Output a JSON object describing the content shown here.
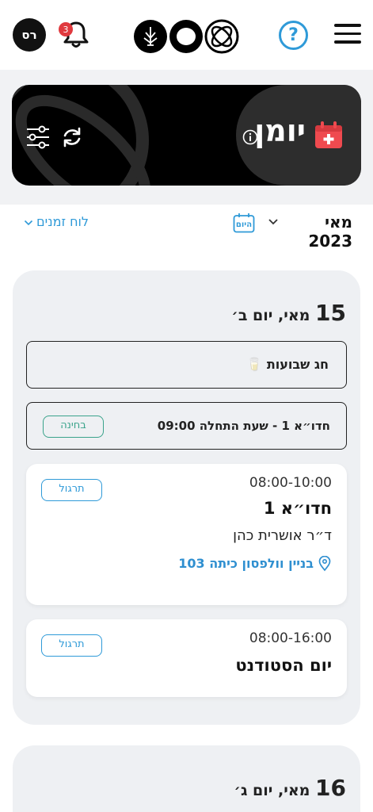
{
  "header": {
    "avatar_initials": "רס",
    "notifications_count": "3",
    "help_label": "?"
  },
  "banner": {
    "title": "יומן"
  },
  "nav": {
    "month_label": "מאי 2023",
    "today_label": "היום",
    "timetable_label": "לוח זמנים"
  },
  "days": [
    {
      "day_number": "15",
      "day_label": "מאי, יום ב׳",
      "holiday": "חג שבועות 🥛",
      "exam": {
        "text": "חדו״א 1 - שעת התחלה 09:00",
        "tag": "בחינה"
      },
      "lessons": [
        {
          "time": "08:00-10:00",
          "title": "חדו״א 1",
          "teacher": "ד״ר אושרית כהן",
          "location": "בניין וולפסון כיתה 103",
          "tag": "תרגול"
        },
        {
          "time": "08:00-16:00",
          "title": "יום הסטודנט",
          "tag": "תרגול"
        }
      ]
    },
    {
      "day_number": "16",
      "day_label": "מאי, יום ג׳"
    }
  ],
  "colors": {
    "accent_blue": "#2f9ad8",
    "exam_green": "#3aa38b",
    "badge_red": "#e0393e",
    "calendar_red": "#ef4a4f"
  }
}
